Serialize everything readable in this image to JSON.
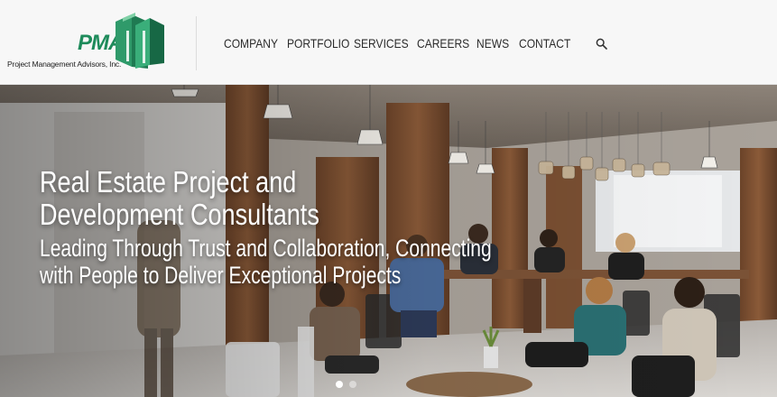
{
  "logo": {
    "mark": "PMA",
    "company_name": "Project Management Advisors, Inc.",
    "icon": "pma-building-logo-icon",
    "brand_color": "#1e8b5b"
  },
  "nav": {
    "items": [
      "COMPANY",
      "PORTFOLIO",
      "SERVICES",
      "CAREERS",
      "NEWS",
      "CONTACT"
    ],
    "search_icon": "search-icon"
  },
  "hero": {
    "title_line1": "Real Estate Project and",
    "title_line2": "Development Consultants",
    "subtitle_line1": "Leading Through Trust and Collaboration, Connecting",
    "subtitle_line2": "with People to Deliver Exceptional Projects",
    "slides": 2,
    "active_slide": 1
  }
}
